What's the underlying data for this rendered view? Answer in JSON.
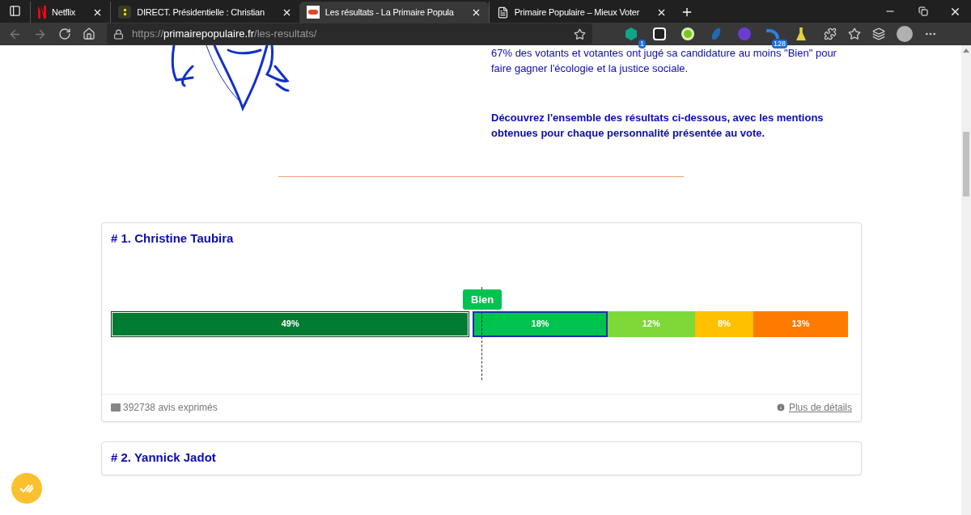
{
  "tabs": [
    {
      "title": "Netflix",
      "kind": "netflix",
      "selected": false
    },
    {
      "title": "DIRECT. Présidentielle : Christian",
      "kind": "news",
      "selected": false
    },
    {
      "title": "Les résultats - La Primaire Popula",
      "kind": "site",
      "selected": true
    },
    {
      "title": "Primaire Populaire – Mieux Voter",
      "kind": "page",
      "selected": false
    }
  ],
  "address": {
    "scheme": "https://",
    "host": "primairepopulaire.fr",
    "path": "/les-resultats/"
  },
  "extensions": [
    {
      "kind": "shield",
      "badge": "1"
    },
    {
      "kind": "notion"
    },
    {
      "kind": "check"
    },
    {
      "kind": "leaf"
    },
    {
      "kind": "en"
    },
    {
      "kind": "wifi",
      "badge": "128"
    },
    {
      "kind": "flask"
    }
  ],
  "intro": [
    "67% des votants et votantes ont jugé sa candidature au moins \"Bien\" pour faire gagner l'écologie et la justice sociale.",
    "Découvrez l'ensemble des résultats ci-dessous, avec les mentions obtenues pour chaque personnalité présentée au vote."
  ],
  "results": [
    {
      "title": "# 1. Christine Taubira",
      "median_label": "Bien",
      "segments": [
        {
          "label": "49%",
          "color": "#007c32",
          "selected": false
        },
        {
          "label": "18%",
          "color": "#00c24f",
          "selected": true
        },
        {
          "label": "12%",
          "color": "#7ed838",
          "selected": false
        },
        {
          "label": "8%",
          "color": "#ffc000",
          "selected": false
        },
        {
          "label": "13%",
          "color": "#ff7b00",
          "selected": false
        }
      ],
      "votes": "392738 avis exprimés",
      "details_link": "Plus de détails"
    },
    {
      "title": "# 2. Yannick Jadot"
    }
  ]
}
